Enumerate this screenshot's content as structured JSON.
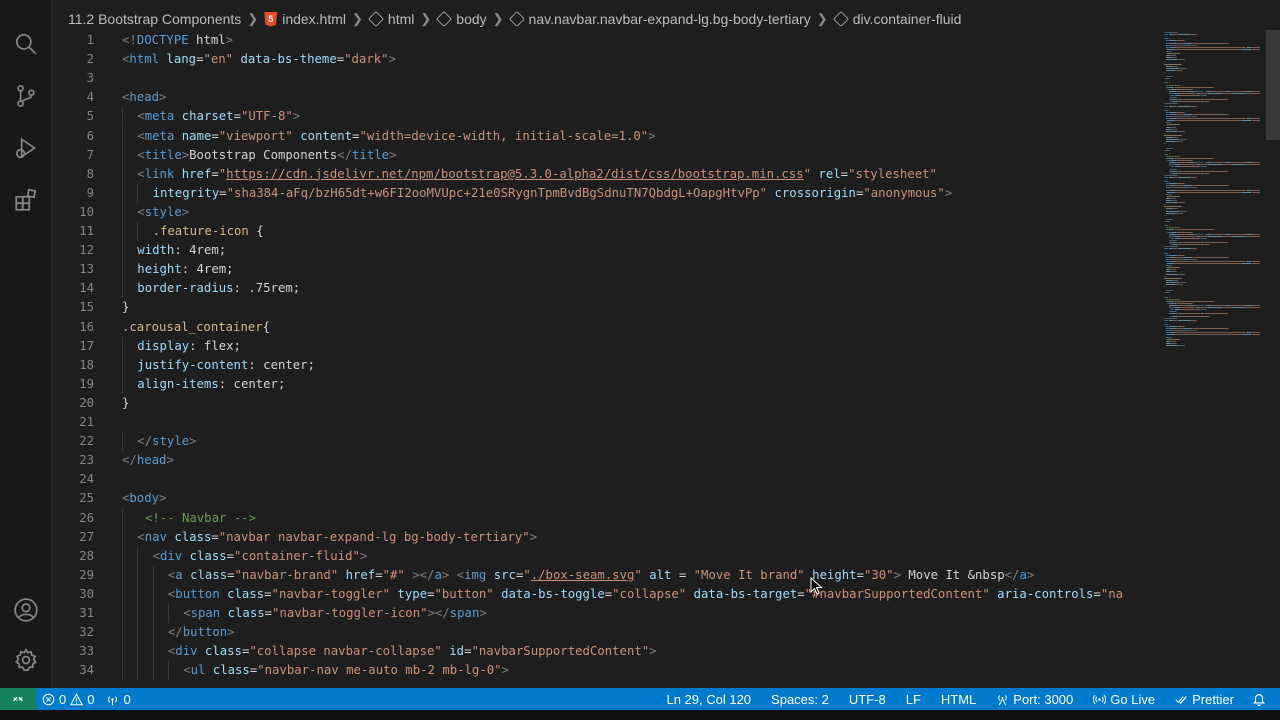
{
  "breadcrumb": [
    {
      "label": "11.2 Bootstrap Components",
      "icon": "none"
    },
    {
      "label": "index.html",
      "icon": "html5-icon"
    },
    {
      "label": "html",
      "icon": "cube-icon"
    },
    {
      "label": "body",
      "icon": "cube-icon"
    },
    {
      "label": "nav.navbar.navbar-expand-lg.bg-body-tertiary",
      "icon": "cube-icon"
    },
    {
      "label": "div.container-fluid",
      "icon": "cube-icon"
    }
  ],
  "activity_bar": [
    "search-icon",
    "source-control-icon",
    "run-debug-icon",
    "extensions-icon",
    "account-icon",
    "settings-gear-icon"
  ],
  "code_lines": [
    {
      "n": "1",
      "indent": 0,
      "tokens": [
        [
          "punc",
          "<!"
        ],
        [
          "tag",
          "DOCTYPE"
        ],
        [
          "txt",
          " html"
        ],
        [
          "punc",
          ">"
        ]
      ]
    },
    {
      "n": "2",
      "indent": 0,
      "tokens": [
        [
          "punc",
          "<"
        ],
        [
          "tag",
          "html"
        ],
        [
          "attr",
          " lang"
        ],
        [
          "txt",
          "="
        ],
        [
          "str",
          "\"en\""
        ],
        [
          "attr",
          " data-bs-theme"
        ],
        [
          "txt",
          "="
        ],
        [
          "str",
          "\"dark\""
        ],
        [
          "punc",
          ">"
        ]
      ]
    },
    {
      "n": "3",
      "indent": 0,
      "tokens": []
    },
    {
      "n": "4",
      "indent": 0,
      "tokens": [
        [
          "punc",
          "<"
        ],
        [
          "tag",
          "head"
        ],
        [
          "punc",
          ">"
        ]
      ]
    },
    {
      "n": "5",
      "indent": 1,
      "tokens": [
        [
          "punc",
          "<"
        ],
        [
          "tag",
          "meta"
        ],
        [
          "attr",
          " charset"
        ],
        [
          "txt",
          "="
        ],
        [
          "str",
          "\"UTF-8\""
        ],
        [
          "punc",
          ">"
        ]
      ]
    },
    {
      "n": "6",
      "indent": 1,
      "tokens": [
        [
          "punc",
          "<"
        ],
        [
          "tag",
          "meta"
        ],
        [
          "attr",
          " name"
        ],
        [
          "txt",
          "="
        ],
        [
          "str",
          "\"viewport\""
        ],
        [
          "attr",
          " content"
        ],
        [
          "txt",
          "="
        ],
        [
          "str",
          "\"width=device-width, initial-scale=1.0\""
        ],
        [
          "punc",
          ">"
        ]
      ]
    },
    {
      "n": "7",
      "indent": 1,
      "tokens": [
        [
          "punc",
          "<"
        ],
        [
          "tag",
          "title"
        ],
        [
          "punc",
          ">"
        ],
        [
          "txt",
          "Bootstrap Components"
        ],
        [
          "punc",
          "</"
        ],
        [
          "tag",
          "title"
        ],
        [
          "punc",
          ">"
        ]
      ]
    },
    {
      "n": "8",
      "indent": 1,
      "tokens": [
        [
          "punc",
          "<"
        ],
        [
          "tag",
          "link"
        ],
        [
          "attr",
          " href"
        ],
        [
          "txt",
          "="
        ],
        [
          "str",
          "\""
        ],
        [
          "link",
          "https://cdn.jsdelivr.net/npm/bootstrap@5.3.0-alpha2/dist/css/bootstrap.min.css"
        ],
        [
          "str",
          "\""
        ],
        [
          "attr",
          " rel"
        ],
        [
          "txt",
          "="
        ],
        [
          "str",
          "\"stylesheet\""
        ]
      ]
    },
    {
      "n": "9",
      "indent": 2,
      "tokens": [
        [
          "attr",
          "integrity"
        ],
        [
          "txt",
          "="
        ],
        [
          "str",
          "\"sha384-aFq/bzH65dt+w6FI2ooMVUpc+21e0SRygnTpmBvdBgSdnuTN7QbdgL+OapgHtvPp\""
        ],
        [
          "attr",
          " crossorigin"
        ],
        [
          "txt",
          "="
        ],
        [
          "str",
          "\"anonymous\""
        ],
        [
          "punc",
          ">"
        ]
      ]
    },
    {
      "n": "10",
      "indent": 1,
      "tokens": [
        [
          "punc",
          "<"
        ],
        [
          "tag",
          "style"
        ],
        [
          "punc",
          ">"
        ]
      ]
    },
    {
      "n": "11",
      "indent": 2,
      "tokens": [
        [
          "sel",
          ".feature-icon"
        ],
        [
          "txt",
          " {"
        ]
      ]
    },
    {
      "n": "12",
      "indent": 1,
      "tokens": [
        [
          "attr",
          "width"
        ],
        [
          "txt",
          ": 4rem;"
        ]
      ]
    },
    {
      "n": "13",
      "indent": 1,
      "tokens": [
        [
          "attr",
          "height"
        ],
        [
          "txt",
          ": 4rem;"
        ]
      ]
    },
    {
      "n": "14",
      "indent": 1,
      "tokens": [
        [
          "attr",
          "border-radius"
        ],
        [
          "txt",
          ": .75rem;"
        ]
      ]
    },
    {
      "n": "15",
      "indent": 0,
      "tokens": [
        [
          "txt",
          "}"
        ]
      ]
    },
    {
      "n": "16",
      "indent": 0,
      "tokens": [
        [
          "sel",
          ".carousal_container"
        ],
        [
          "txt",
          "{"
        ]
      ]
    },
    {
      "n": "17",
      "indent": 1,
      "tokens": [
        [
          "attr",
          "display"
        ],
        [
          "txt",
          ": flex;"
        ]
      ]
    },
    {
      "n": "18",
      "indent": 1,
      "tokens": [
        [
          "attr",
          "justify-content"
        ],
        [
          "txt",
          ": center;"
        ]
      ]
    },
    {
      "n": "19",
      "indent": 1,
      "tokens": [
        [
          "attr",
          "align-items"
        ],
        [
          "txt",
          ": center;"
        ]
      ]
    },
    {
      "n": "20",
      "indent": 0,
      "tokens": [
        [
          "txt",
          "}"
        ]
      ]
    },
    {
      "n": "21",
      "indent": 0,
      "tokens": []
    },
    {
      "n": "22",
      "indent": 1,
      "tokens": [
        [
          "punc",
          "</"
        ],
        [
          "tag",
          "style"
        ],
        [
          "punc",
          ">"
        ]
      ]
    },
    {
      "n": "23",
      "indent": 0,
      "tokens": [
        [
          "punc",
          "</"
        ],
        [
          "tag",
          "head"
        ],
        [
          "punc",
          ">"
        ]
      ]
    },
    {
      "n": "24",
      "indent": 0,
      "tokens": []
    },
    {
      "n": "25",
      "indent": 0,
      "tokens": [
        [
          "punc",
          "<"
        ],
        [
          "tag",
          "body"
        ],
        [
          "punc",
          ">"
        ]
      ]
    },
    {
      "n": "26",
      "indent": 1.5,
      "tokens": [
        [
          "com",
          "<!-- Navbar -->"
        ]
      ]
    },
    {
      "n": "27",
      "indent": 1,
      "tokens": [
        [
          "punc",
          "<"
        ],
        [
          "tag",
          "nav"
        ],
        [
          "attr",
          " class"
        ],
        [
          "txt",
          "="
        ],
        [
          "str",
          "\"navbar navbar-expand-lg bg-body-tertiary\""
        ],
        [
          "punc",
          ">"
        ]
      ]
    },
    {
      "n": "28",
      "indent": 2,
      "tokens": [
        [
          "punc",
          "<"
        ],
        [
          "tag",
          "div"
        ],
        [
          "attr",
          " class"
        ],
        [
          "txt",
          "="
        ],
        [
          "str",
          "\"container-fluid\""
        ],
        [
          "punc",
          ">"
        ]
      ]
    },
    {
      "n": "29",
      "indent": 3,
      "tokens": [
        [
          "punc",
          "<"
        ],
        [
          "tag",
          "a"
        ],
        [
          "attr",
          " class"
        ],
        [
          "txt",
          "="
        ],
        [
          "str",
          "\"navbar-brand\""
        ],
        [
          "attr",
          " href"
        ],
        [
          "txt",
          "="
        ],
        [
          "str",
          "\"#\""
        ],
        [
          "punc",
          " ></"
        ],
        [
          "tag",
          "a"
        ],
        [
          "punc",
          ">"
        ],
        [
          "punc",
          " <"
        ],
        [
          "tag",
          "img"
        ],
        [
          "attr",
          " src"
        ],
        [
          "txt",
          "="
        ],
        [
          "str",
          "\""
        ],
        [
          "link",
          "./box-seam.svg"
        ],
        [
          "str",
          "\""
        ],
        [
          "attr",
          " alt"
        ],
        [
          "txt",
          " = "
        ],
        [
          "str",
          "\"Move It brand\""
        ],
        [
          "attr",
          " height"
        ],
        [
          "txt",
          "="
        ],
        [
          "str",
          "\"30\""
        ],
        [
          "punc",
          ">"
        ],
        [
          "txt",
          " Move It &nbsp"
        ],
        [
          "punc",
          "</"
        ],
        [
          "tag",
          "a"
        ],
        [
          "punc",
          ">"
        ]
      ]
    },
    {
      "n": "30",
      "indent": 3,
      "tokens": [
        [
          "punc",
          "<"
        ],
        [
          "tag",
          "button"
        ],
        [
          "attr",
          " class"
        ],
        [
          "txt",
          "="
        ],
        [
          "str",
          "\"navbar-toggler\""
        ],
        [
          "attr",
          " type"
        ],
        [
          "txt",
          "="
        ],
        [
          "str",
          "\"button\""
        ],
        [
          "attr",
          " data-bs-toggle"
        ],
        [
          "txt",
          "="
        ],
        [
          "str",
          "\"collapse\""
        ],
        [
          "attr",
          " data-bs-target"
        ],
        [
          "txt",
          "="
        ],
        [
          "str",
          "\"#navbarSupportedContent\""
        ],
        [
          "attr",
          " aria-controls"
        ],
        [
          "txt",
          "="
        ],
        [
          "str",
          "\"na"
        ]
      ]
    },
    {
      "n": "31",
      "indent": 4,
      "tokens": [
        [
          "punc",
          "<"
        ],
        [
          "tag",
          "span"
        ],
        [
          "attr",
          " class"
        ],
        [
          "txt",
          "="
        ],
        [
          "str",
          "\"navbar-toggler-icon\""
        ],
        [
          "punc",
          "></"
        ],
        [
          "tag",
          "span"
        ],
        [
          "punc",
          ">"
        ]
      ]
    },
    {
      "n": "32",
      "indent": 3,
      "tokens": [
        [
          "punc",
          "</"
        ],
        [
          "tag",
          "button"
        ],
        [
          "punc",
          ">"
        ]
      ]
    },
    {
      "n": "33",
      "indent": 3,
      "tokens": [
        [
          "punc",
          "<"
        ],
        [
          "tag",
          "div"
        ],
        [
          "attr",
          " class"
        ],
        [
          "txt",
          "="
        ],
        [
          "str",
          "\"collapse navbar-collapse\""
        ],
        [
          "attr",
          " id"
        ],
        [
          "txt",
          "="
        ],
        [
          "str",
          "\"navbarSupportedContent\""
        ],
        [
          "punc",
          ">"
        ]
      ]
    },
    {
      "n": "34",
      "indent": 4,
      "tokens": [
        [
          "punc",
          "<"
        ],
        [
          "tag",
          "ul"
        ],
        [
          "attr",
          " class"
        ],
        [
          "txt",
          "="
        ],
        [
          "str",
          "\"navbar-nav me-auto mb-2 mb-lg-0\""
        ],
        [
          "punc",
          ">"
        ]
      ]
    }
  ],
  "status": {
    "errors": "0",
    "warnings": "0",
    "ports": "0",
    "position": "Ln 29, Col 120",
    "spaces": "Spaces: 2",
    "encoding": "UTF-8",
    "eol": "LF",
    "language": "HTML",
    "port": "Port: 3000",
    "golive": "Go Live",
    "prettier": "Prettier"
  },
  "colors": {
    "statusbar": "#007acc",
    "remote": "#16825d",
    "tag": "#569cd6",
    "attr": "#9cdcfe",
    "string": "#ce9178",
    "comment": "#6a9955"
  }
}
